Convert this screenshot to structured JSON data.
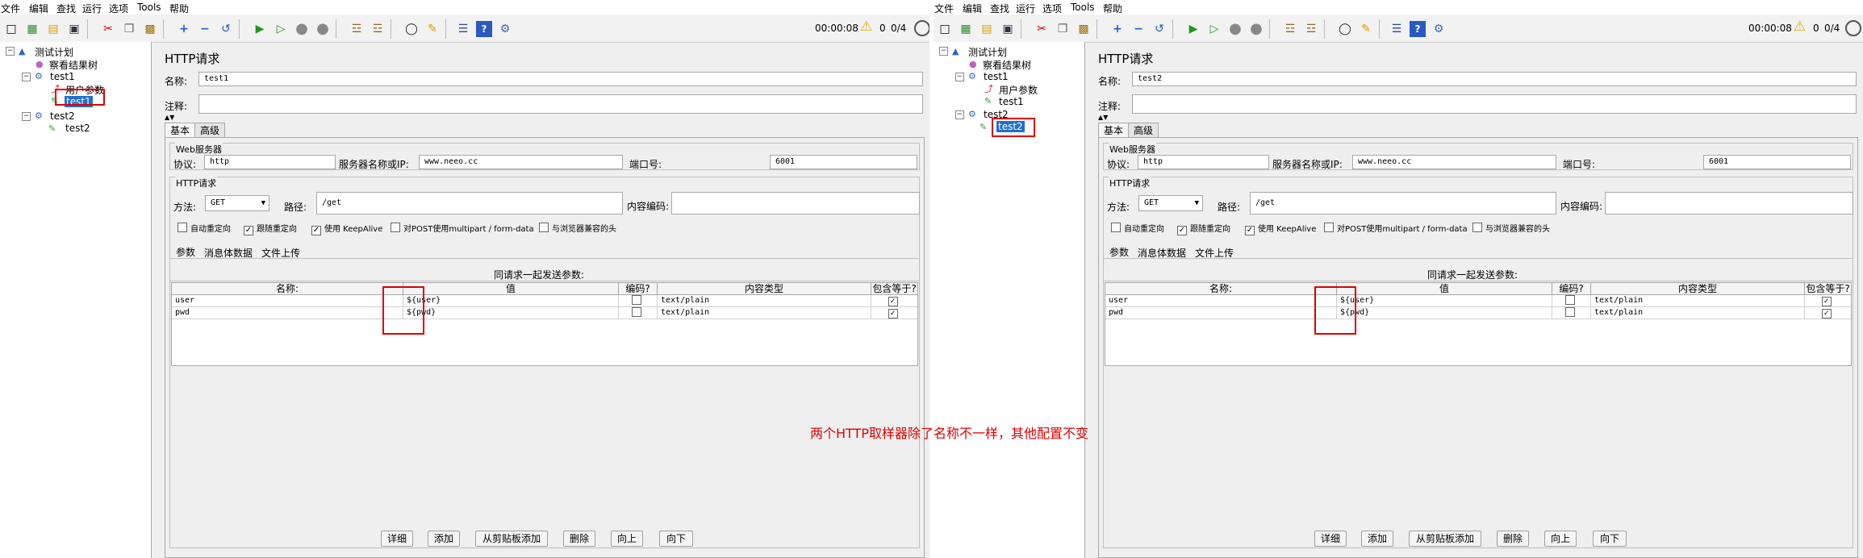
{
  "menu": [
    "文件",
    "编辑",
    "查找",
    "运行",
    "选项",
    "Tools",
    "帮助"
  ],
  "toolbar": {
    "elapsed": "00:00:08",
    "warnings": "0",
    "threads": "0/4"
  },
  "tree": {
    "plan": "测试计划",
    "listener": "察看结果树",
    "group1": "test1",
    "user_params": "用户参数",
    "group2": "test2"
  },
  "labels": {
    "name": "名称:",
    "comment": "注释:",
    "tab_basic": "基本",
    "tab_advanced": "高级",
    "web_server": "Web服务器",
    "protocol": "协议:",
    "server": "服务器名称或IP:",
    "port": "端口号:",
    "http_request": "HTTP请求",
    "method": "方法:",
    "path": "路径:",
    "encoding": "内容编码:",
    "cb_auto_redirect": "自动重定向",
    "cb_follow_redirect": "跟随重定向",
    "cb_keepalive": "使用 KeepAlive",
    "cb_multipart": "对POST使用multipart / form-data",
    "cb_browser_headers": "与浏览器兼容的头",
    "subtab_params": "参数",
    "subtab_body": "消息体数据",
    "subtab_files": "文件上传",
    "send_params": "同请求一起发送参数:",
    "col_name": "名称:",
    "col_value": "值",
    "col_encode": "编码?",
    "col_ctype": "内容类型",
    "col_include": "包含等于?",
    "btn_detail": "详细",
    "btn_add": "添加",
    "btn_add_clip": "从剪贴板添加",
    "btn_delete": "删除",
    "btn_up": "向上",
    "btn_down": "向下"
  },
  "left": {
    "panel_title": "HTTP请求",
    "sampler_name": "test1",
    "protocol": "http",
    "server": "www.neeo.cc",
    "port": "6001",
    "method": "GET",
    "path": "/get"
  },
  "right": {
    "panel_title": "HTTP请求",
    "sampler_name": "test2",
    "protocol": "http",
    "server": "www.neeo.cc",
    "port": "6001",
    "method": "GET",
    "path": "/get"
  },
  "params": [
    {
      "name": "user",
      "value": "${user}",
      "ctype": "text/plain"
    },
    {
      "name": "pwd",
      "value": "${pwd}",
      "ctype": "text/plain"
    }
  ],
  "annotation": "两个HTTP取样器除了名称不一样，其他配置不变"
}
